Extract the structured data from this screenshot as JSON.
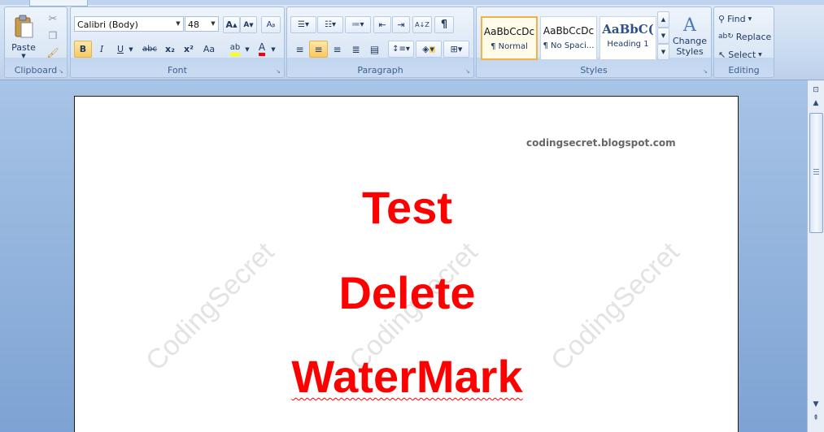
{
  "ribbon": {
    "clipboard": {
      "group_label": "Clipboard",
      "paste_label": "Paste"
    },
    "font": {
      "group_label": "Font",
      "font_name": "Calibri (Body)",
      "font_size": "48",
      "bold": "B",
      "italic": "I",
      "underline": "U",
      "strikethrough": "abc",
      "subscript": "x₂",
      "superscript": "x²",
      "change_case": "Aa"
    },
    "paragraph": {
      "group_label": "Paragraph",
      "show_marks": "¶",
      "sort": "A↓Z"
    },
    "styles": {
      "group_label": "Styles",
      "items": [
        {
          "sample": "AaBbCcDc",
          "name": "¶ Normal"
        },
        {
          "sample": "AaBbCcDc",
          "name": "¶ No Spaci..."
        },
        {
          "sample": "AaBbC(",
          "name": "Heading 1"
        }
      ],
      "change_styles_label": "Change Styles"
    },
    "editing": {
      "group_label": "Editing",
      "find": "Find",
      "replace": "Replace",
      "select": "Select"
    }
  },
  "document": {
    "header": "codingsecret.blogspot.com",
    "lines": [
      "Test",
      "Delete",
      "WaterMark"
    ],
    "watermark": "CodingSecret",
    "text_color": "#ff0000"
  }
}
